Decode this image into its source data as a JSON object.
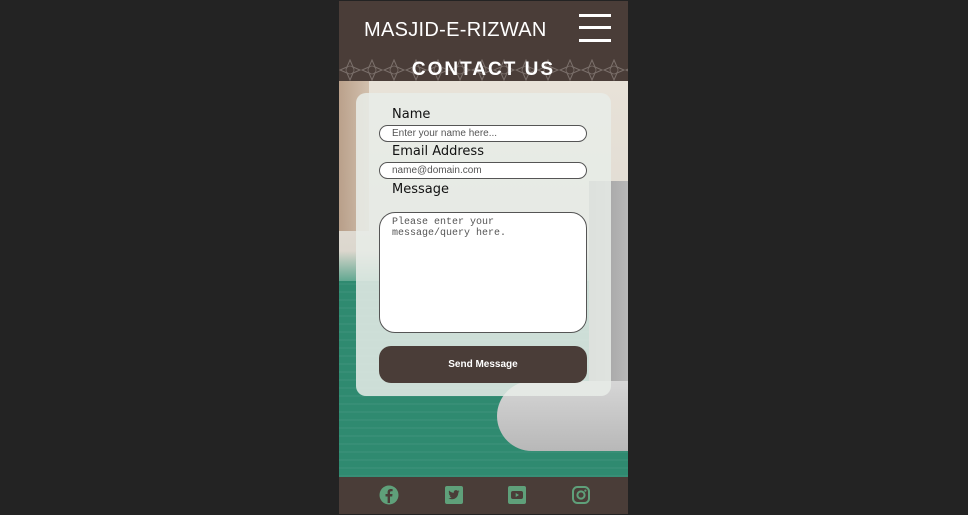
{
  "header": {
    "site_title": "MASJID-E-RIZWAN",
    "menu_icon": "hamburger-menu-icon"
  },
  "banner": {
    "title": "CONTACT US"
  },
  "form": {
    "name_label": "Name",
    "name_placeholder": "Enter your name here...",
    "email_label": "Email Address",
    "email_placeholder": "name@domain.com",
    "message_label": "Message",
    "message_placeholder": "Please enter your message/query here.",
    "submit_label": "Send Message"
  },
  "footer": {
    "icons": [
      "facebook-icon",
      "twitter-icon",
      "youtube-icon",
      "instagram-icon"
    ]
  },
  "colors": {
    "page_bg": "#232323",
    "brand_brown": "#4a3d38",
    "social_green": "#5fa07a",
    "carpet_green": "#2f8a70"
  }
}
